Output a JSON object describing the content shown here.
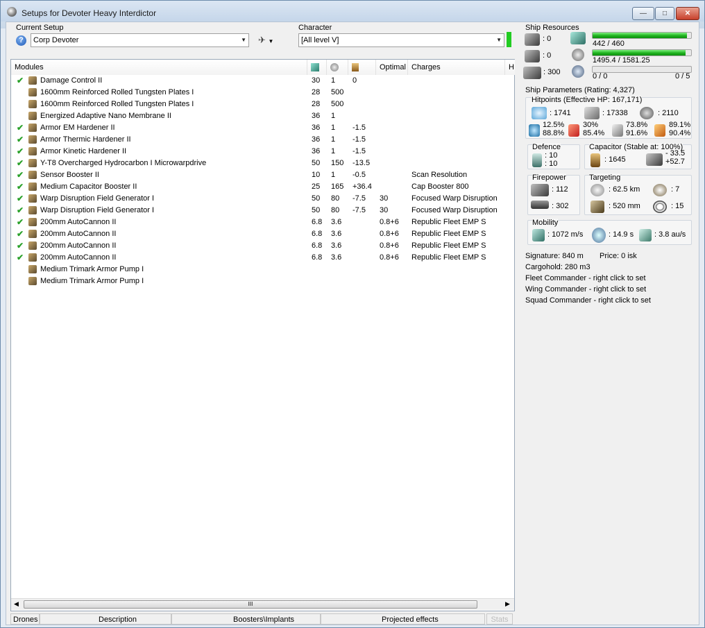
{
  "window": {
    "title": "Setups for Devoter Heavy Interdictor",
    "buttons": {
      "minimize": "—",
      "maximize": "□",
      "close": "✕"
    }
  },
  "setup": {
    "label": "Current Setup",
    "value": "Corp Devoter",
    "help": "?"
  },
  "character": {
    "label": "Character",
    "value": "[All level V]",
    "status_color": "#22cc22"
  },
  "modules": {
    "headers": [
      "Modules",
      "",
      "",
      "",
      "Optimal",
      "Charges",
      "H"
    ],
    "header_icons": [
      "cpu-icon",
      "powergrid-icon",
      "capacitor-icon"
    ],
    "rows": [
      {
        "checked": true,
        "name": "Damage Control II",
        "cpu": "30",
        "pg": "1",
        "cap": "0",
        "optimal": "",
        "charge": ""
      },
      {
        "checked": false,
        "name": "1600mm Reinforced Rolled Tungsten Plates I",
        "cpu": "28",
        "pg": "500",
        "cap": "",
        "optimal": "",
        "charge": ""
      },
      {
        "checked": false,
        "name": "1600mm Reinforced Rolled Tungsten Plates I",
        "cpu": "28",
        "pg": "500",
        "cap": "",
        "optimal": "",
        "charge": ""
      },
      {
        "checked": false,
        "name": "Energized Adaptive Nano Membrane II",
        "cpu": "36",
        "pg": "1",
        "cap": "",
        "optimal": "",
        "charge": ""
      },
      {
        "checked": true,
        "name": "Armor EM Hardener II",
        "cpu": "36",
        "pg": "1",
        "cap": "-1.5",
        "optimal": "",
        "charge": ""
      },
      {
        "checked": true,
        "name": "Armor Thermic Hardener II",
        "cpu": "36",
        "pg": "1",
        "cap": "-1.5",
        "optimal": "",
        "charge": ""
      },
      {
        "checked": true,
        "name": "Armor Kinetic Hardener II",
        "cpu": "36",
        "pg": "1",
        "cap": "-1.5",
        "optimal": "",
        "charge": ""
      },
      {
        "checked": true,
        "name": "Y-T8 Overcharged Hydrocarbon I Microwarpdrive",
        "cpu": "50",
        "pg": "150",
        "cap": "-13.5",
        "optimal": "",
        "charge": ""
      },
      {
        "checked": true,
        "name": "Sensor Booster II",
        "cpu": "10",
        "pg": "1",
        "cap": "-0.5",
        "optimal": "",
        "charge": "Scan Resolution"
      },
      {
        "checked": true,
        "name": "Medium Capacitor Booster II",
        "cpu": "25",
        "pg": "165",
        "cap": "+36.4",
        "optimal": "",
        "charge": "Cap Booster 800"
      },
      {
        "checked": true,
        "name": "Warp Disruption Field Generator I",
        "cpu": "50",
        "pg": "80",
        "cap": "-7.5",
        "optimal": "30",
        "charge": "Focused Warp Disruption"
      },
      {
        "checked": true,
        "name": "Warp Disruption Field Generator I",
        "cpu": "50",
        "pg": "80",
        "cap": "-7.5",
        "optimal": "30",
        "charge": "Focused Warp Disruption"
      },
      {
        "checked": true,
        "name": "200mm AutoCannon II",
        "cpu": "6.8",
        "pg": "3.6",
        "cap": "",
        "optimal": "0.8+6",
        "charge": "Republic Fleet EMP S"
      },
      {
        "checked": true,
        "name": "200mm AutoCannon II",
        "cpu": "6.8",
        "pg": "3.6",
        "cap": "",
        "optimal": "0.8+6",
        "charge": "Republic Fleet EMP S"
      },
      {
        "checked": true,
        "name": "200mm AutoCannon II",
        "cpu": "6.8",
        "pg": "3.6",
        "cap": "",
        "optimal": "0.8+6",
        "charge": "Republic Fleet EMP S"
      },
      {
        "checked": true,
        "name": "200mm AutoCannon II",
        "cpu": "6.8",
        "pg": "3.6",
        "cap": "",
        "optimal": "0.8+6",
        "charge": "Republic Fleet EMP S"
      },
      {
        "checked": false,
        "name": "Medium Trimark Armor Pump I",
        "cpu": "",
        "pg": "",
        "cap": "",
        "optimal": "",
        "charge": ""
      },
      {
        "checked": false,
        "name": "Medium Trimark Armor Pump I",
        "cpu": "",
        "pg": "",
        "cap": "",
        "optimal": "",
        "charge": ""
      }
    ]
  },
  "statusbar": {
    "drones": "Drones",
    "description": "Description",
    "boosters": "Boosters\\Implants",
    "projected": "Projected effects",
    "stats": "Stats"
  },
  "resources": {
    "title": "Ship Resources",
    "turrets": ": 0",
    "launchers": ": 0",
    "calibration": ": 300",
    "cpu": {
      "text": "442 / 460",
      "used": 442,
      "total": 460
    },
    "powergrid": {
      "text": "1495.4 / 1581.25",
      "used": 1495.4,
      "total": 1581.25
    },
    "drones": {
      "text_left": "0 / 0",
      "text_right": "0 / 5",
      "used": 0,
      "total": 0
    }
  },
  "parameters": {
    "title": "Ship Parameters (Rating: 4,327)",
    "hitpoints_label": "Hitpoints (Effective HP: 167,171)",
    "shield_hp": ": 1741",
    "armor_hp": ": 17338",
    "structure_hp": ": 2110",
    "resists": {
      "em": [
        "12.5%",
        "88.8%"
      ],
      "thermal": [
        "30%",
        "85.4%"
      ],
      "kinetic": [
        "73.8%",
        "91.6%"
      ],
      "explosive": [
        "89.1%",
        "90.4%"
      ]
    },
    "defence_label": "Defence",
    "defence": [
      ": 10",
      ": 10"
    ],
    "capacitor_label": "Capacitor (Stable at: 100%)",
    "capacitor": ": 1645",
    "cap_delta": [
      "- 33.5",
      "+52.7"
    ],
    "firepower_label": "Firepower",
    "firepower": [
      ": 112",
      ": 302"
    ],
    "targeting_label": "Targeting",
    "target_range": ": 62.5 km",
    "target_count": ": 7",
    "scan_res": ": 520 mm",
    "sensor_str": ": 15",
    "mobility_label": "Mobility",
    "speed": ": 1072 m/s",
    "align": ": 14.9 s",
    "warp": ": 3.8 au/s",
    "signature": "Signature: 840 m",
    "price": "Price: 0 isk",
    "cargohold": "Cargohold: 280 m3",
    "fleet_commander": "Fleet Commander - right click to set",
    "wing_commander": "Wing Commander - right click to set",
    "squad_commander": "Squad Commander - right click to set"
  }
}
